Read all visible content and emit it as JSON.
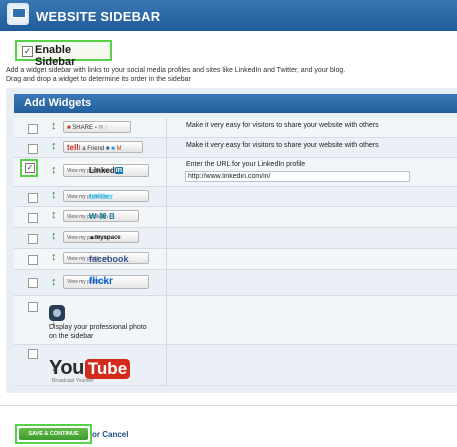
{
  "header": {
    "title": "WEBSITE SIDEBAR",
    "icon": "sidebar-window-icon"
  },
  "enable_sidebar": {
    "label": "Enable Sidebar",
    "checked": true
  },
  "description": {
    "line1": "Add a widget sidebar with links to your social media profiles and sites like LinkedIn and Twitter, and your blog.",
    "line2": "Drag and drop a widget to determine its order in the sidebar"
  },
  "widgets_panel": {
    "title": "Add Widgets",
    "rows": [
      {
        "name": "share",
        "button_text": "SHARE",
        "checked": false,
        "description": "Make it very easy for visitors to share your website with others"
      },
      {
        "name": "tell-a-friend",
        "button_text": "a Friend",
        "button_prefix": "tell",
        "checked": false,
        "description": "Make it very easy for visitors to share your website with others"
      },
      {
        "name": "linkedin",
        "view_text": "View my profile on",
        "brand": "Linked",
        "brand_suffix": "in",
        "checked": true,
        "description": "Enter the URL for your LinkedIn profile",
        "input_value": "http://www.linkedin.com/in/"
      },
      {
        "name": "twitter",
        "view_text": "View my profile on",
        "brand": "twitter",
        "checked": false
      },
      {
        "name": "wordpress",
        "view_text": "View my profile on",
        "brand": "W ⌘ B",
        "checked": false
      },
      {
        "name": "myspace",
        "view_text": "View my profile on",
        "brand": "myspace",
        "checked": false
      },
      {
        "name": "facebook",
        "view_text": "View my profile on",
        "brand": "facebook",
        "checked": false
      },
      {
        "name": "flickr",
        "view_text": "View my profile on",
        "brand": "flickr",
        "checked": false
      },
      {
        "name": "photo",
        "text": "Display your professional photo on the sidebar",
        "checked": false
      },
      {
        "name": "youtube",
        "you": "You",
        "tube": "Tube",
        "tagline": "Broadcast Yourself",
        "checked": false
      }
    ]
  },
  "footer": {
    "save_label": "SAVE & CONTINUE",
    "or_cancel": "or Cancel"
  },
  "colors": {
    "header_blue": "#2a68a8",
    "highlight_green": "#57d14a",
    "save_green": "#4fa83a"
  }
}
